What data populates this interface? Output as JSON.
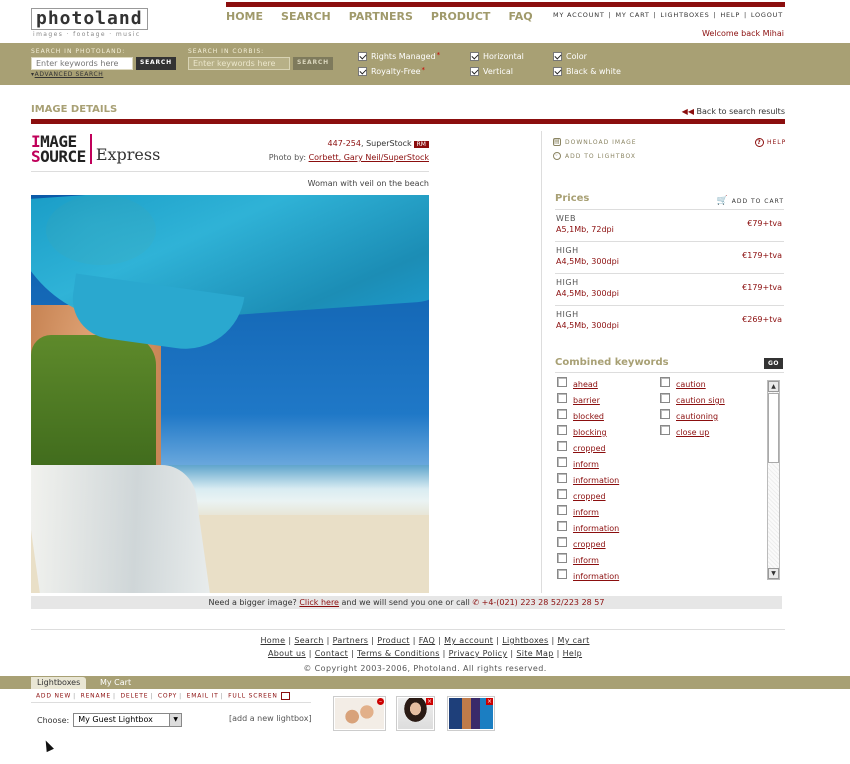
{
  "header": {
    "logo_word": "photoland",
    "logo_tag": "images · footage · music",
    "nav": [
      "HOME",
      "SEARCH",
      "PARTNERS",
      "PRODUCT",
      "FAQ"
    ],
    "user_nav": [
      "MY ACCOUNT",
      "MY CART",
      "LIGHTBOXES",
      "HELP",
      "LOGOUT"
    ],
    "welcome": "Welcome back Mihai"
  },
  "search": {
    "label_photoland": "SEARCH IN PHOTOLAND:",
    "placeholder_photoland": "Enter keywords here",
    "button_photoland": "SEARCH",
    "advanced": "ADVANCED SEARCH",
    "label_corbis": "SEARCH IN CORBIS:",
    "placeholder_corbis": "Enter keywords here",
    "button_corbis": "SEARCH",
    "filters": [
      {
        "label": "Rights Managed",
        "checked": true,
        "star": true
      },
      {
        "label": "Royalty-Free",
        "checked": true,
        "star": true
      },
      {
        "label": "Horizontal",
        "checked": true,
        "star": false
      },
      {
        "label": "Vertical",
        "checked": true,
        "star": false
      },
      {
        "label": "Color",
        "checked": true,
        "star": false
      },
      {
        "label": "Black & white",
        "checked": true,
        "star": false
      }
    ],
    "star_glyph": "*"
  },
  "details": {
    "title": "IMAGE DETAILS",
    "back": "Back to search results",
    "brand_line1": "IMAGE",
    "brand_line2": "SOURCE",
    "brand_ex": "Express",
    "code": "447-254",
    "agency": "SuperStock",
    "license_badge": "RM",
    "photo_by_label": "Photo by:",
    "photo_by": "Corbett, Gary Neil/SuperStock",
    "caption": "Woman with veil on the beach",
    "bigger_pre": "Need a bigger image?",
    "bigger_link": "Click here",
    "bigger_post": "and we will send you one or call",
    "phone": "+4-(021) 223 28 52/223 28 57"
  },
  "actions": {
    "download": "DOWNLOAD IMAGE",
    "add_lightbox": "ADD TO LIGHTBOX",
    "help": "HELP"
  },
  "prices": {
    "title": "Prices",
    "add_to_cart": "ADD TO CART",
    "rows": [
      {
        "type": "WEB",
        "desc": "A5,1Mb, 72dpi",
        "price": "€79+tva"
      },
      {
        "type": "HIGH",
        "desc": "A4,5Mb, 300dpi",
        "price": "€179+tva"
      },
      {
        "type": "HIGH",
        "desc": "A4,5Mb, 300dpi",
        "price": "€179+tva"
      },
      {
        "type": "HIGH",
        "desc": "A4,5Mb, 300dpi",
        "price": "€269+tva"
      }
    ]
  },
  "keywords": {
    "title": "Combined keywords",
    "go": "GO",
    "col1": [
      "ahead",
      "barrier",
      "blocked",
      "blocking",
      "cropped",
      "inform",
      "information",
      "cropped",
      "inform",
      "information",
      "cropped",
      "inform",
      "information"
    ],
    "col2": [
      "caution",
      "caution sign",
      "cautioning",
      "close up"
    ]
  },
  "footer": {
    "row1": [
      "Home",
      "Search",
      "Partners",
      "Product",
      "FAQ",
      "My account",
      "Lightboxes",
      "My cart"
    ],
    "row2": [
      "About us",
      "Contact",
      "Terms & Conditions",
      "Privacy Policy",
      "Site Map",
      "Help"
    ],
    "copyright": "© Copyright  2003-2006, Photoland. All rights reserved."
  },
  "lightbox": {
    "tab_lightboxes": "Lightboxes",
    "tab_cart": "My Cart",
    "actions": [
      "ADD NEW",
      "RENAME",
      "DELETE",
      "COPY",
      "EMAIL IT",
      "FULL SCREEN"
    ],
    "choose_label": "Choose:",
    "selected": "My Guest Lightbox",
    "add_new": "[add a new lightbox]"
  },
  "colors": {
    "accent": "#8b0e0e",
    "olive": "#a8a074"
  }
}
